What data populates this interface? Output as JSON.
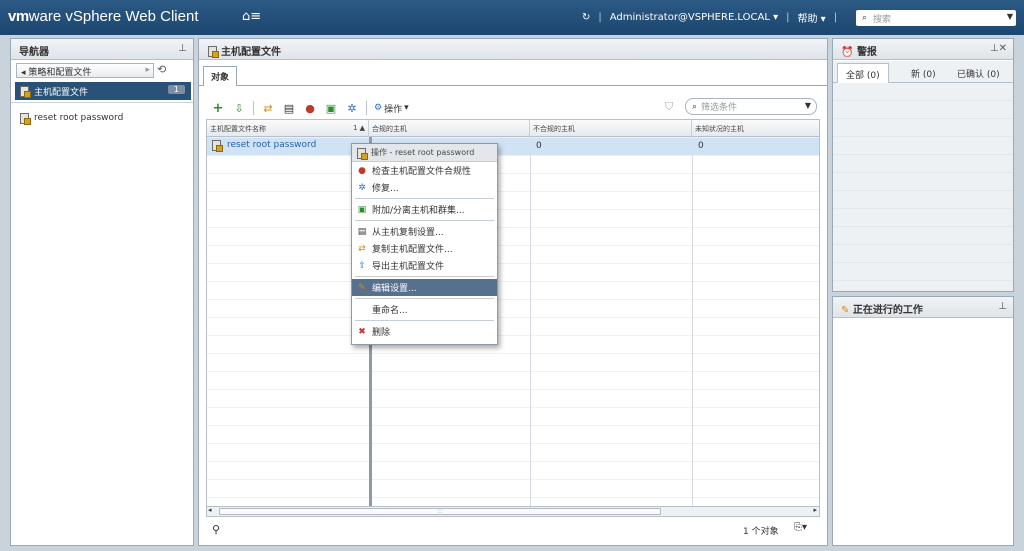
{
  "topbar": {
    "brand_vm": "vm",
    "brand_ware": "ware",
    "brand_product": " vSphere Web Client",
    "user": "Administrator@VSPHERE.LOCAL",
    "help": "帮助",
    "search_placeholder": "搜索"
  },
  "navigator": {
    "title": "导航器",
    "back_label": "策略和配置文件",
    "selected_label": "主机配置文件",
    "selected_count": "1",
    "items": [
      {
        "label": "reset root password"
      }
    ]
  },
  "main": {
    "title": "主机配置文件",
    "tab_objects": "对象",
    "actions_label": "操作",
    "filter_placeholder": "筛选条件",
    "columns": {
      "name": "主机配置文件名称",
      "sort": "1 ▲",
      "compliant": "合规的主机",
      "noncompliant": "不合规的主机",
      "unknown": "未知状况的主机"
    },
    "rows": [
      {
        "name": "reset root password",
        "compliant": "",
        "noncompliant": "0",
        "unknown": "0"
      }
    ],
    "object_count": "1 个对象"
  },
  "context_menu": {
    "header": "操作 - reset root password",
    "items": [
      {
        "label": "检查主机配置文件合规性"
      },
      {
        "label": "修复..."
      },
      {
        "label": "附加/分离主机和群集..."
      },
      {
        "label": "从主机复制设置..."
      },
      {
        "label": "复制主机配置文件..."
      },
      {
        "label": "导出主机配置文件"
      },
      {
        "label": "编辑设置..."
      },
      {
        "label": "重命名..."
      },
      {
        "label": "删除"
      }
    ]
  },
  "alarms": {
    "title": "警报",
    "tab_all": "全部 (0)",
    "tab_new": "新 (0)",
    "tab_ack": "已确认 (0)"
  },
  "work": {
    "title": "正在进行的工作"
  },
  "colors": {
    "topbar": "#1c4670",
    "selection": "#2a5278",
    "row_selected": "#cfe3f5",
    "menu_highlight": "#56708d"
  }
}
